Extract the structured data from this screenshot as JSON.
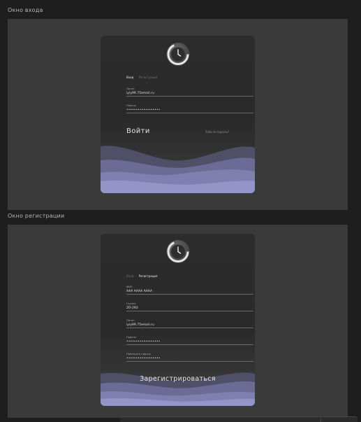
{
  "login_section": {
    "title": "Окно входа",
    "tabs": {
      "active": "Вход",
      "inactive": "Регистрация"
    },
    "fields": [
      {
        "label": "Логин",
        "value": "iyiy99.75email.ru"
      },
      {
        "label": "Пароль",
        "value": "••••••••••••••••••"
      }
    ],
    "submit_label": "Войти",
    "forgot_label": "Забыли пароль?"
  },
  "register_section": {
    "title": "Окно регистрации",
    "tabs": {
      "inactive": "Вход",
      "active": "Регистрация"
    },
    "fields": [
      {
        "label": "ФИО",
        "value": "ААА АААА АААА"
      },
      {
        "label": "Группа",
        "value": "2П-293"
      },
      {
        "label": "Логин",
        "value": "iyiy99.75email.ru"
      },
      {
        "label": "Пароль",
        "value": "••••••••••••••••••"
      },
      {
        "label": "Повторите пароль",
        "value": "••••••••••••••••••"
      }
    ],
    "submit_label": "Зарегистрироваться"
  },
  "colors": {
    "background": "#1e1e1e",
    "frame": "#3a3a3a",
    "card": "#2c2c2c",
    "wave_accent": "#8d8dc4"
  },
  "icons": {
    "logo": "clock-icon"
  }
}
